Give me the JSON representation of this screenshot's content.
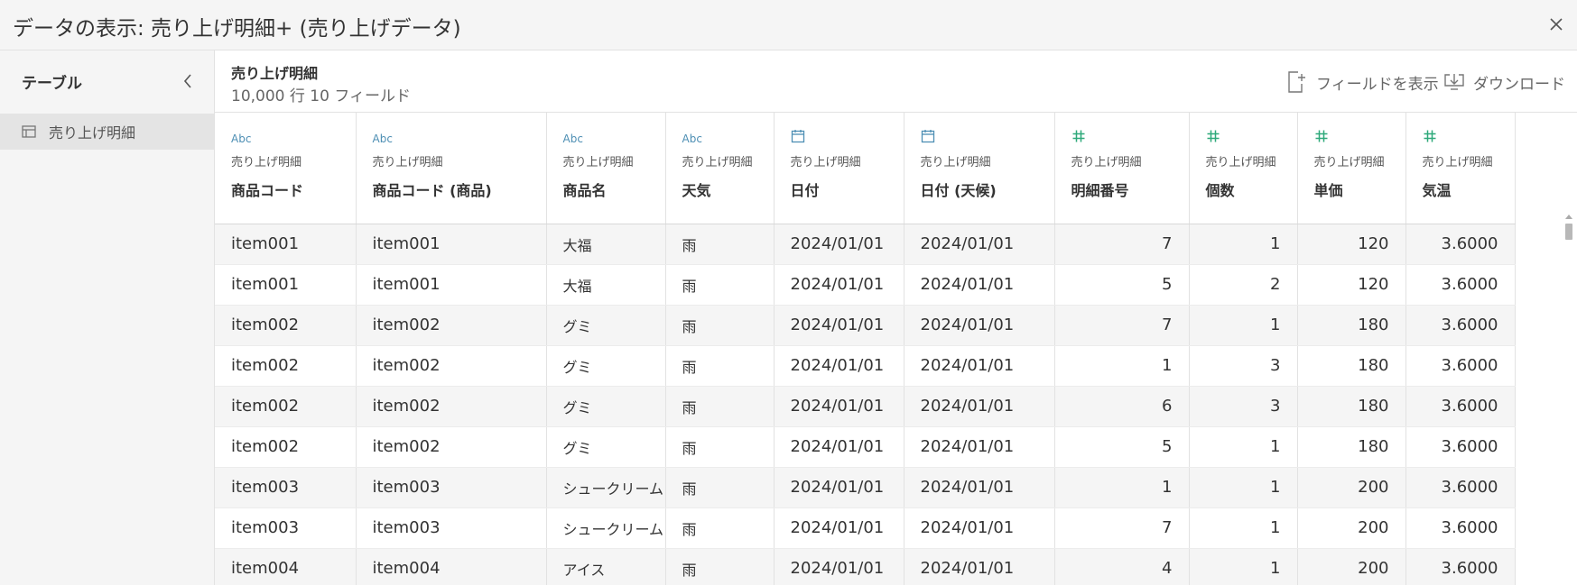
{
  "window": {
    "title": "データの表示: 売り上げ明細+ (売り上げデータ)",
    "close_icon": "close-icon"
  },
  "sidebar": {
    "header": "テーブル",
    "collapse_icon": "chevron-left-icon",
    "items": [
      {
        "label": "売り上げ明細",
        "icon": "table-icon"
      }
    ]
  },
  "main": {
    "table_name": "売り上げ明細",
    "table_meta": "10,000 行 10 フィールド",
    "actions": {
      "show_fields": "フィールドを表示",
      "download": "ダウンロード"
    }
  },
  "colors": {
    "string_icon": "#4e8fb4",
    "date_icon": "#4e8fb4",
    "number_icon": "#2ea97a",
    "row_stripe": "#f5f5f5",
    "panel_bg": "#f5f5f5"
  },
  "columns": [
    {
      "type": "string",
      "type_label": "Abc",
      "source": "売り上げ明細",
      "name": "商品コード"
    },
    {
      "type": "string",
      "type_label": "Abc",
      "source": "売り上げ明細",
      "name": "商品コード (商品)"
    },
    {
      "type": "string",
      "type_label": "Abc",
      "source": "売り上げ明細",
      "name": "商品名"
    },
    {
      "type": "string",
      "type_label": "Abc",
      "source": "売り上げ明細",
      "name": "天気"
    },
    {
      "type": "date",
      "type_label": "",
      "source": "売り上げ明細",
      "name": "日付"
    },
    {
      "type": "date",
      "type_label": "",
      "source": "売り上げ明細",
      "name": "日付 (天候)"
    },
    {
      "type": "number",
      "type_label": "",
      "source": "売り上げ明細",
      "name": "明細番号"
    },
    {
      "type": "number",
      "type_label": "",
      "source": "売り上げ明細",
      "name": "個数"
    },
    {
      "type": "number",
      "type_label": "",
      "source": "売り上げ明細",
      "name": "単価"
    },
    {
      "type": "number",
      "type_label": "",
      "source": "売り上げ明細",
      "name": "気温"
    }
  ],
  "rows": [
    [
      "item001",
      "item001",
      "大福",
      "雨",
      "2024/01/01",
      "2024/01/01",
      "7",
      "1",
      "120",
      "3.6000"
    ],
    [
      "item001",
      "item001",
      "大福",
      "雨",
      "2024/01/01",
      "2024/01/01",
      "5",
      "2",
      "120",
      "3.6000"
    ],
    [
      "item002",
      "item002",
      "グミ",
      "雨",
      "2024/01/01",
      "2024/01/01",
      "7",
      "1",
      "180",
      "3.6000"
    ],
    [
      "item002",
      "item002",
      "グミ",
      "雨",
      "2024/01/01",
      "2024/01/01",
      "1",
      "3",
      "180",
      "3.6000"
    ],
    [
      "item002",
      "item002",
      "グミ",
      "雨",
      "2024/01/01",
      "2024/01/01",
      "6",
      "3",
      "180",
      "3.6000"
    ],
    [
      "item002",
      "item002",
      "グミ",
      "雨",
      "2024/01/01",
      "2024/01/01",
      "5",
      "1",
      "180",
      "3.6000"
    ],
    [
      "item003",
      "item003",
      "シュークリーム",
      "雨",
      "2024/01/01",
      "2024/01/01",
      "1",
      "1",
      "200",
      "3.6000"
    ],
    [
      "item003",
      "item003",
      "シュークリーム",
      "雨",
      "2024/01/01",
      "2024/01/01",
      "7",
      "1",
      "200",
      "3.6000"
    ],
    [
      "item004",
      "item004",
      "アイス",
      "雨",
      "2024/01/01",
      "2024/01/01",
      "4",
      "1",
      "200",
      "3.6000"
    ]
  ]
}
